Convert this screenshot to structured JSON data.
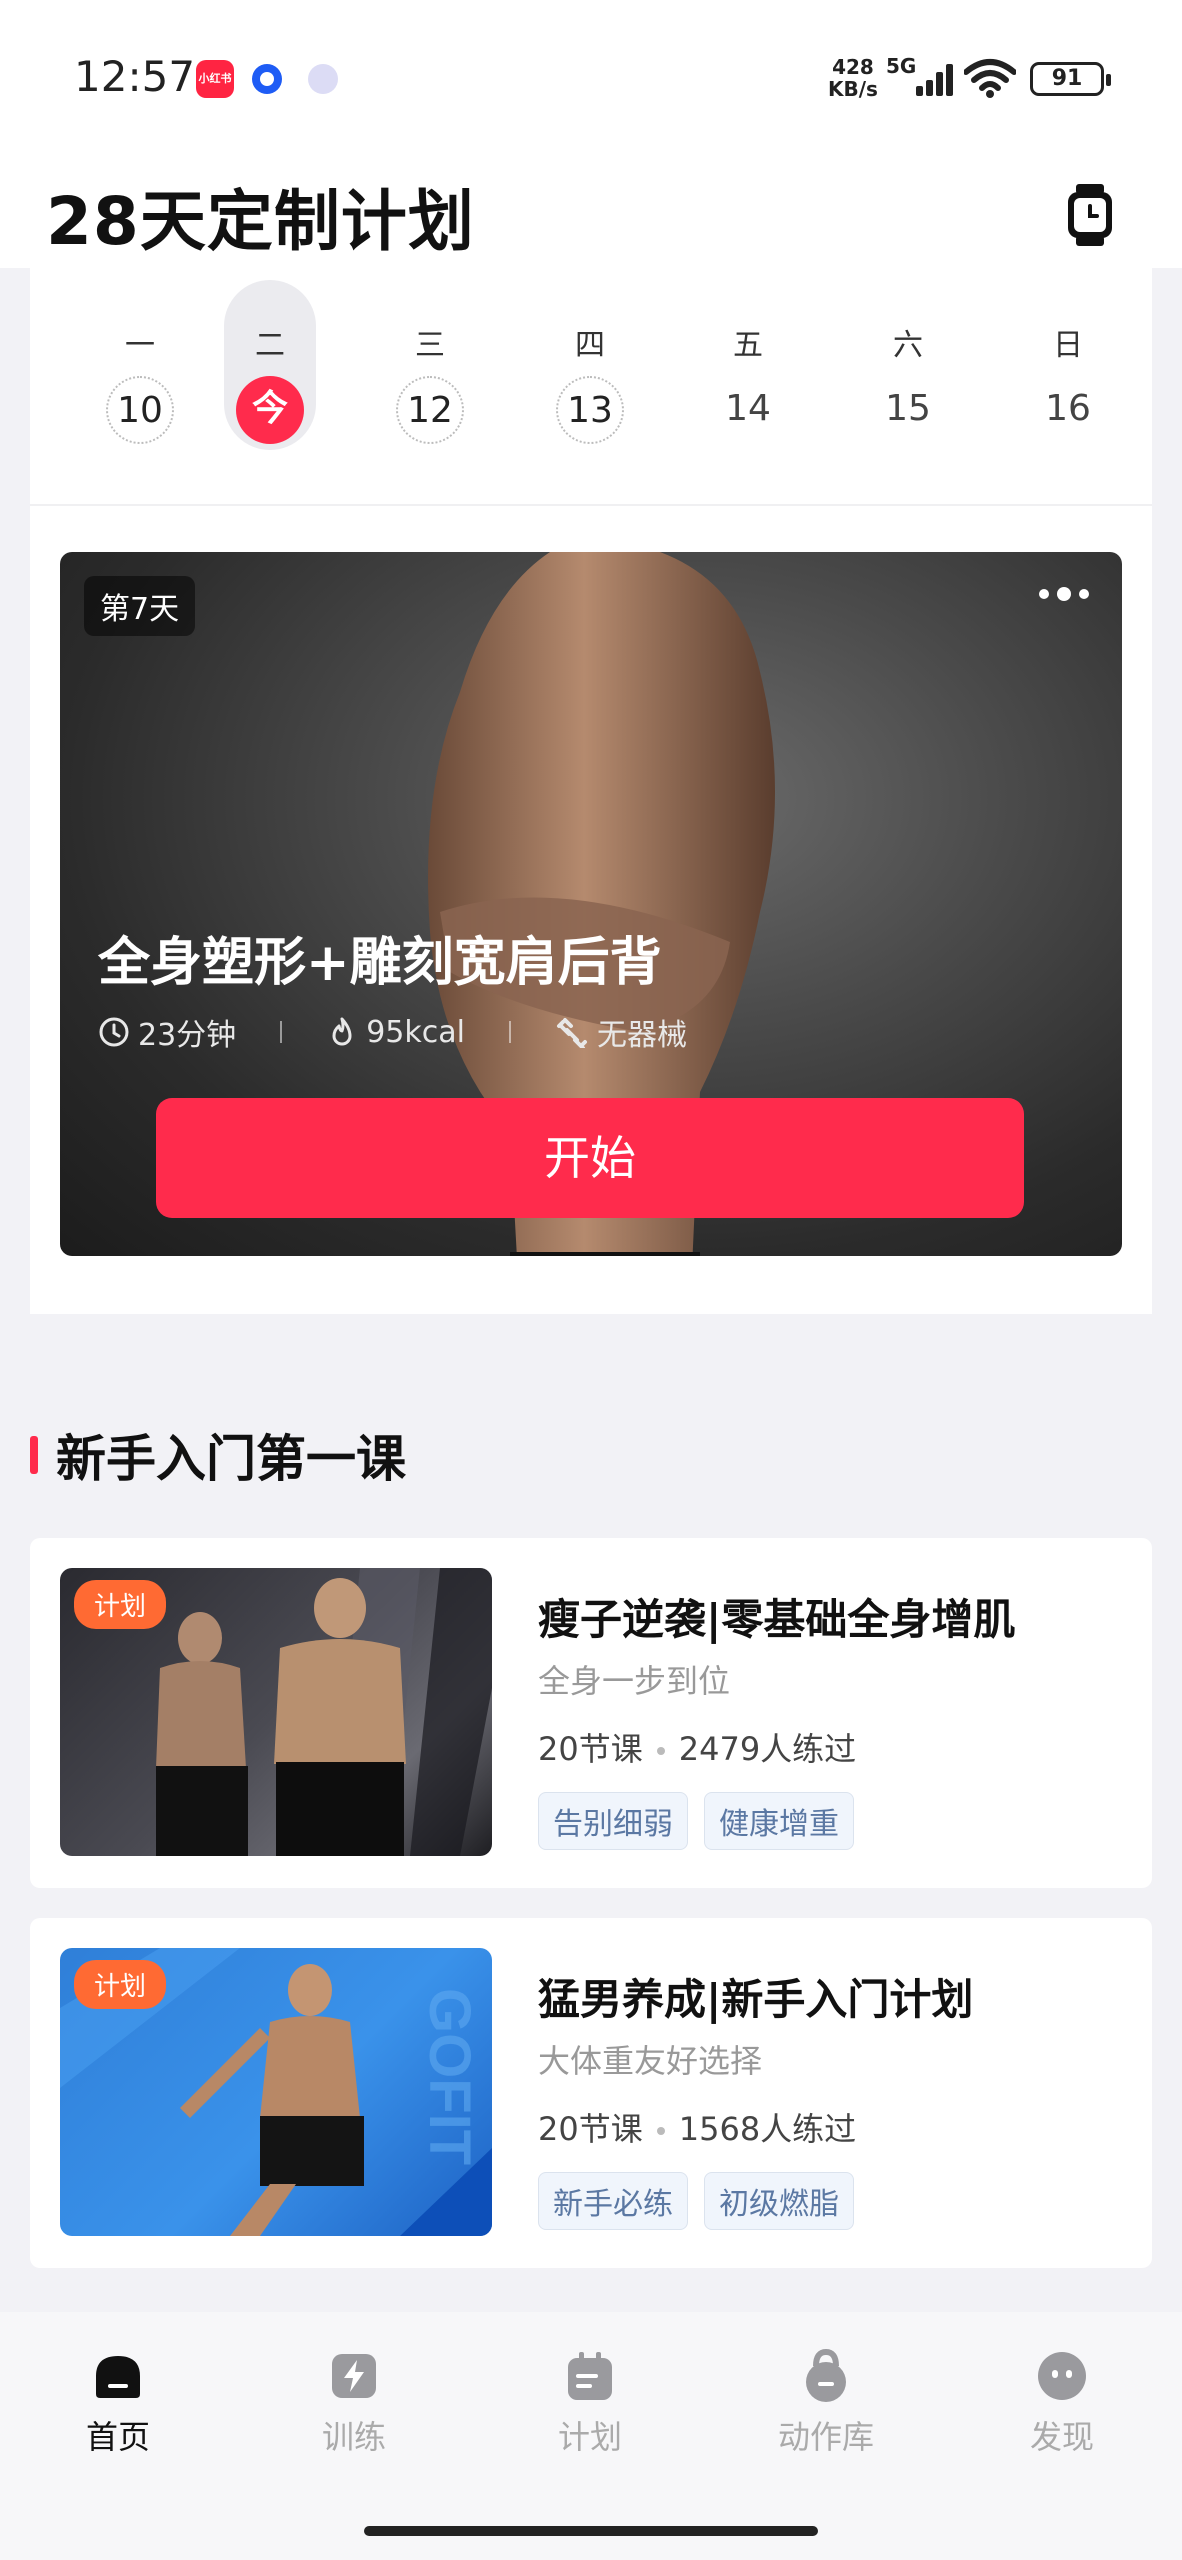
{
  "status_bar": {
    "time": "12:57",
    "app_icon_label": "小红书",
    "speed_value": "428",
    "speed_unit": "KB/s",
    "network": "5G",
    "battery": "91"
  },
  "header": {
    "title": "28天定制计划",
    "right_icon": "watch-icon"
  },
  "week": {
    "days": [
      {
        "name": "一",
        "num": "10"
      },
      {
        "name": "二",
        "num": "今"
      },
      {
        "name": "三",
        "num": "12"
      },
      {
        "name": "四",
        "num": "13"
      },
      {
        "name": "五",
        "num": "14"
      },
      {
        "name": "六",
        "num": "15"
      },
      {
        "name": "日",
        "num": "16"
      }
    ]
  },
  "workout": {
    "day_badge": "第7天",
    "title": "全身塑形+雕刻宽肩后背",
    "duration": "23分钟",
    "calories": "95kcal",
    "equipment": "无器械",
    "start_label": "开始"
  },
  "section": {
    "title": "新手入门第一课"
  },
  "courses": [
    {
      "badge": "计划",
      "title": "瘦子逆袭|零基础全身增肌",
      "subtitle": "全身一步到位",
      "lessons": "20节课",
      "trained": "2479人练过",
      "tags": [
        "告别细弱",
        "健康增重"
      ]
    },
    {
      "badge": "计划",
      "title": "猛男养成|新手入门计划",
      "subtitle": "大体重友好选择",
      "lessons": "20节课",
      "trained": "1568人练过",
      "tags": [
        "新手必练",
        "初级燃脂"
      ]
    }
  ],
  "bottom_nav": {
    "items": [
      {
        "label": "首页",
        "icon": "home-icon",
        "active": true
      },
      {
        "label": "训练",
        "icon": "training-icon",
        "active": false
      },
      {
        "label": "计划",
        "icon": "plan-icon",
        "active": false
      },
      {
        "label": "动作库",
        "icon": "kettlebell-icon",
        "active": false
      },
      {
        "label": "发现",
        "icon": "discover-icon",
        "active": false
      }
    ]
  },
  "colors": {
    "accent": "#ff2b4c",
    "badge_orange": "#ff6a33",
    "tag_text": "#5b78a3",
    "background": "#f2f2f6"
  }
}
